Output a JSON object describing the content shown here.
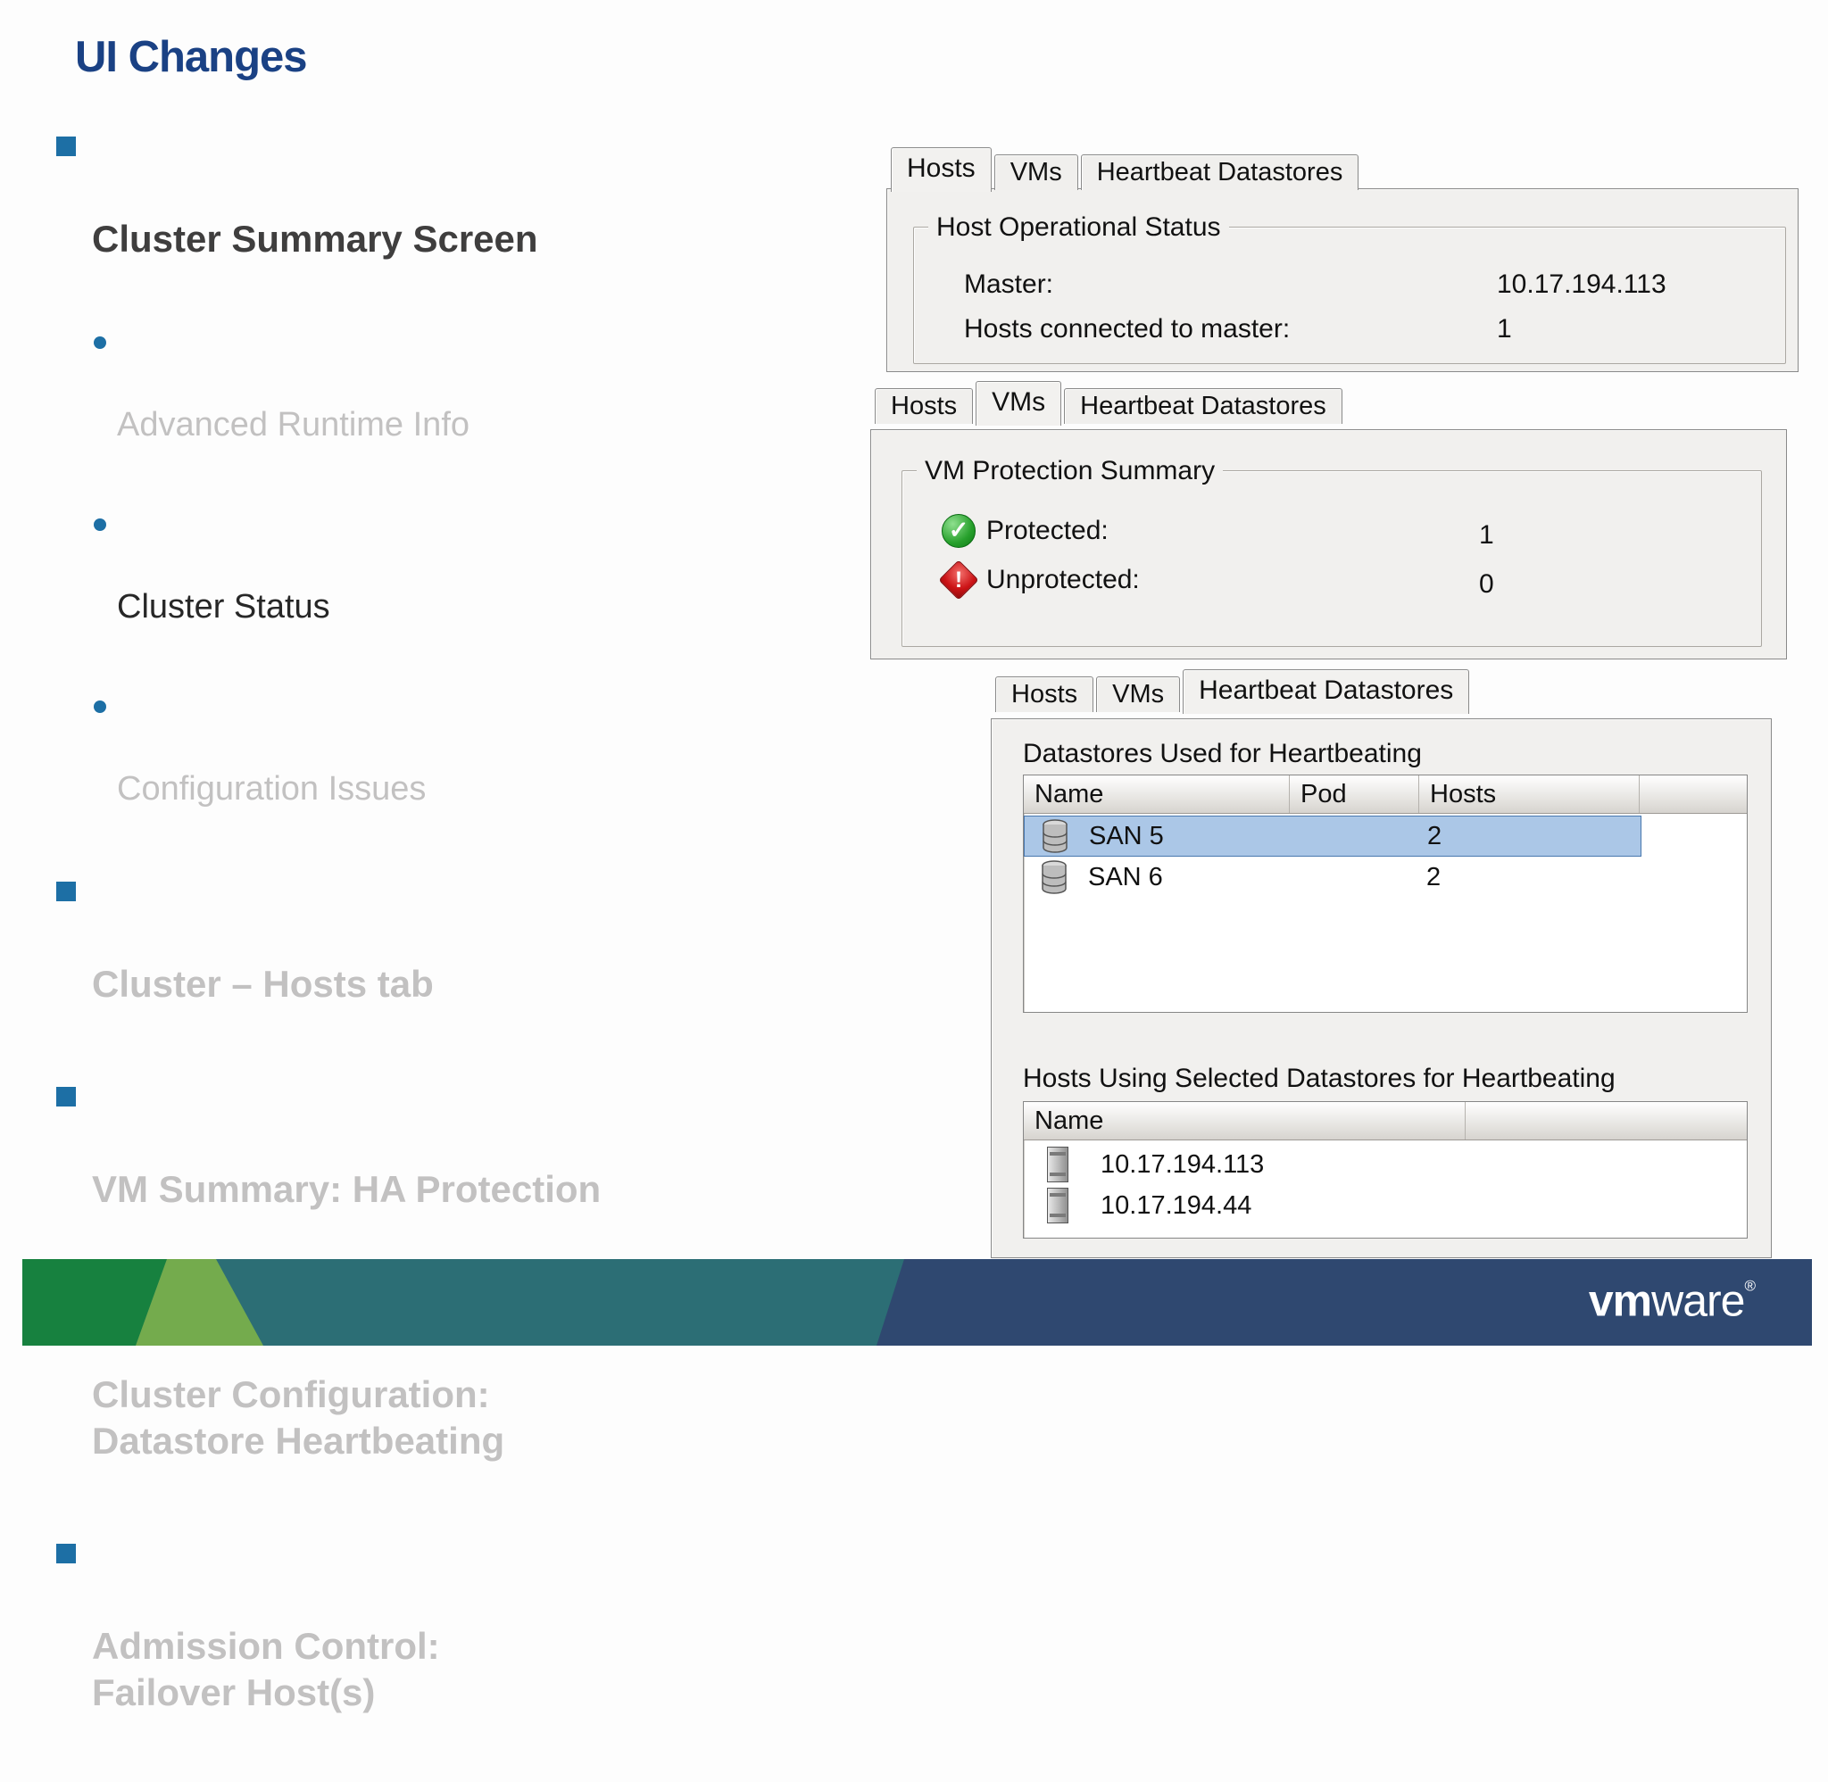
{
  "slide": {
    "title": "UI Changes",
    "bullets": [
      {
        "label": "Cluster Summary Screen"
      },
      {
        "label": "Advanced Runtime Info"
      },
      {
        "label": "Cluster Status"
      },
      {
        "label": "Configuration Issues"
      },
      {
        "label": "Cluster – Hosts tab"
      },
      {
        "label": "VM Summary: HA Protection"
      },
      {
        "label": "Cluster Configuration:\nDatastore Heartbeating"
      },
      {
        "label": "Admission Control:\nFailover Host(s)"
      }
    ]
  },
  "panels": {
    "hosts": {
      "tabs": [
        {
          "label": "Hosts"
        },
        {
          "label": "VMs"
        },
        {
          "label": "Heartbeat Datastores"
        }
      ],
      "group_title": "Host Operational Status",
      "rows": [
        {
          "label": "Master:",
          "value": "10.17.194.113"
        },
        {
          "label": "Hosts connected to master:",
          "value": "1"
        }
      ]
    },
    "vms": {
      "tabs": [
        {
          "label": "Hosts"
        },
        {
          "label": "VMs"
        },
        {
          "label": "Heartbeat Datastores"
        }
      ],
      "group_title": "VM Protection Summary",
      "rows": [
        {
          "icon": "protected-check-icon",
          "label": "Protected:",
          "value": "1"
        },
        {
          "icon": "unprotected-alert-icon",
          "label": "Unprotected:",
          "value": "0"
        }
      ]
    },
    "heartbeat": {
      "tabs": [
        {
          "label": "Hosts"
        },
        {
          "label": "VMs"
        },
        {
          "label": "Heartbeat Datastores"
        }
      ],
      "section1_title": "Datastores Used for Heartbeating",
      "datastores_table": {
        "columns": [
          "Name",
          "Pod",
          "Hosts",
          ""
        ],
        "rows": [
          {
            "name": "SAN 5",
            "pod": "",
            "hosts": "2",
            "selected": true
          },
          {
            "name": "SAN 6",
            "pod": "",
            "hosts": "2",
            "selected": false
          }
        ]
      },
      "section2_title": "Hosts Using Selected Datastores for Heartbeating",
      "hosts_table": {
        "columns": [
          "Name",
          ""
        ],
        "rows": [
          {
            "name": "10.17.194.113"
          },
          {
            "name": "10.17.194.44"
          }
        ]
      }
    }
  },
  "footer": {
    "logo_bold": "vm",
    "logo_rest": "ware",
    "registered": "®"
  },
  "colors": {
    "title_blue": "#1a4184",
    "bullet_blue": "#1d6fa5",
    "muted_gray": "#c2c1c1",
    "dark_text": "#3f3e3e",
    "footer_teal": "#2c6e75",
    "footer_navy": "#2f4870",
    "footer_dark_green": "#17813f",
    "footer_light_green": "#74ab4d",
    "selection_blue": "#abc7e7"
  }
}
